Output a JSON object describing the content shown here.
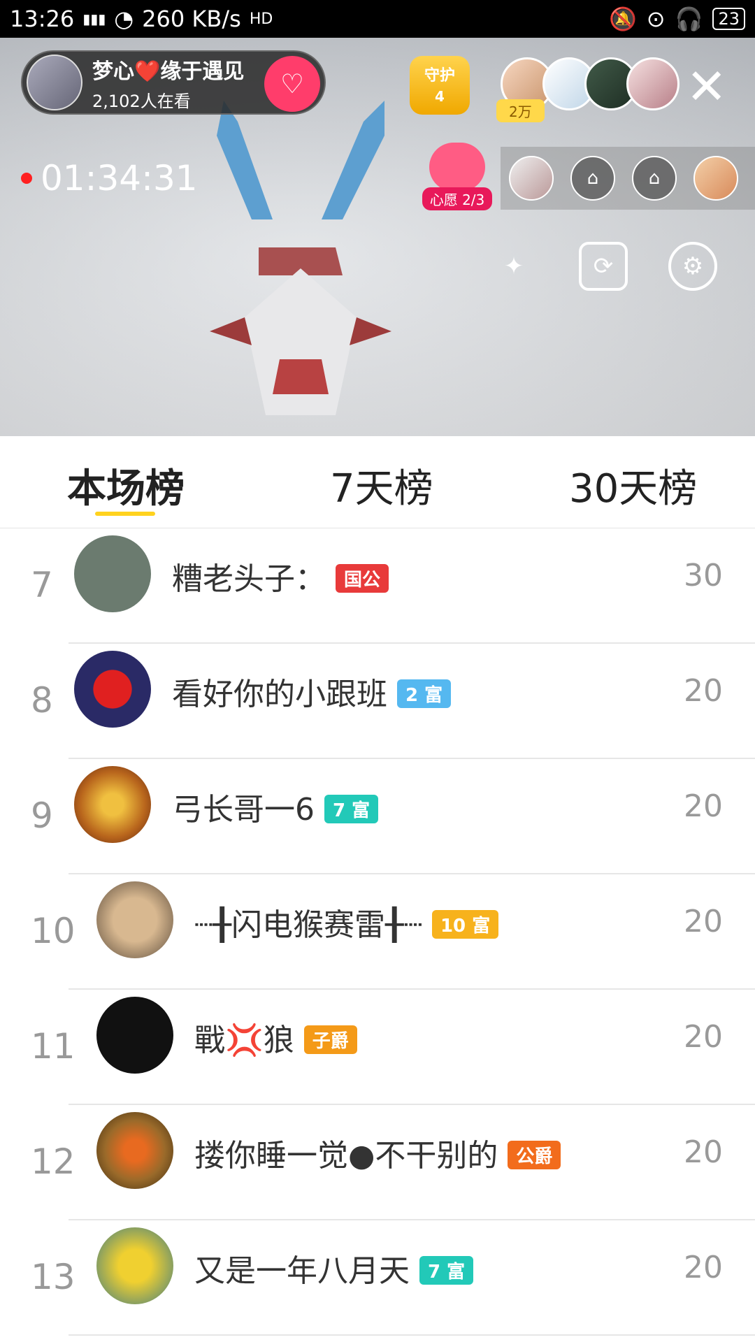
{
  "status_bar": {
    "time": "13:26",
    "network": "4G",
    "speed": "260 KB/s",
    "hd": "HD",
    "battery": "23"
  },
  "live": {
    "host_name": "梦心❤️缘于遇见",
    "viewers": "2,102人在看",
    "follow_icon": "heart-plus-icon",
    "guard_label": "守护",
    "guard_count": "4",
    "fans_label": "2万",
    "close_icon": "close-icon",
    "timer": "01:34:31",
    "wish_label": "心愿 2/3",
    "tools": [
      "magic-wand-icon",
      "camera-flip-icon",
      "settings-icon"
    ]
  },
  "tabs": [
    "本场榜",
    "7天榜",
    "30天榜"
  ],
  "active_tab": 0,
  "rankings": [
    {
      "rank": "7",
      "name": "糟老头子：",
      "badge": "国公",
      "badge_color": "#e83a3a",
      "score": "30",
      "avatar_color": "#6b7b6f"
    },
    {
      "rank": "8",
      "name": "看好你的小跟班",
      "badge": "2 富",
      "badge_color": "#55b8f0",
      "score": "20",
      "avatar_color": "#2a2a66"
    },
    {
      "rank": "9",
      "name": "弓长哥一6",
      "badge": "7 富",
      "badge_color": "#22c9b8",
      "score": "20",
      "avatar_color": "#b8651c"
    },
    {
      "rank": "10",
      "name": "┈╂闪电猴赛雷╂┈",
      "badge": "10 富",
      "badge_color": "#f7b21c",
      "score": "20",
      "avatar_color": "#9a8a6a"
    },
    {
      "rank": "11",
      "name": "戰💢狼",
      "badge": "子爵",
      "badge_color": "#f49a18",
      "score": "20",
      "avatar_color": "#111111"
    },
    {
      "rank": "12",
      "name": "搂你睡一觉●不干别的",
      "badge": "公爵",
      "badge_color": "#f26c1c",
      "score": "20",
      "avatar_color": "#9a6a2a"
    },
    {
      "rank": "13",
      "name": "又是一年八月天",
      "badge": "7 富",
      "badge_color": "#22c9b8",
      "score": "20",
      "avatar_color": "#c8c070"
    }
  ]
}
